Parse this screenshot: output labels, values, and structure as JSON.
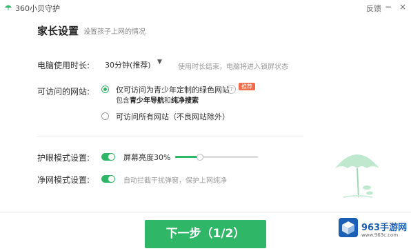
{
  "titlebar": {
    "app_title": "360小贝守护",
    "link": "反馈",
    "minimize_glyph": "−",
    "close_glyph": "×"
  },
  "header": {
    "title": "家长设置",
    "subtitle": "设置孩子上网的情况"
  },
  "usage_time": {
    "label": "电脑使用时长:",
    "value": "30分钟(推荐)",
    "arrow_glyph": "▼",
    "hint": "使用时长结束，电脑将进入锁屏状态"
  },
  "sites": {
    "label": "可访问的网站:",
    "option1": {
      "text": "仅可访问为青少年定制的绿色网站",
      "sub_prefix": "包含",
      "sub_bold1": "青少年导航",
      "sub_and": "和",
      "sub_bold2": "纯净搜索",
      "help_glyph": "?",
      "badge": "推荐"
    },
    "option2": {
      "text": "可访问所有网站（不良网站除外）"
    }
  },
  "eye_mode": {
    "label": "护眼模式设置:",
    "brightness_label": "屏幕亮度30%",
    "brightness": 0.3
  },
  "net_mode": {
    "label": "净网模式设置:",
    "hint": "自动拦截干扰弹窗，保护上网纯净"
  },
  "footer": {
    "next_button": "下一步（1/2）"
  },
  "watermark": {
    "name": "963手游网",
    "url": "www.963c.com"
  },
  "colors": {
    "accent": "#2fb667",
    "badge": "#f26b4b",
    "watermark": "#1a5fb4"
  },
  "icons": {
    "app": "app-logo-icon",
    "help": "question-icon",
    "illustration": "umbrella-plant-illustration"
  }
}
